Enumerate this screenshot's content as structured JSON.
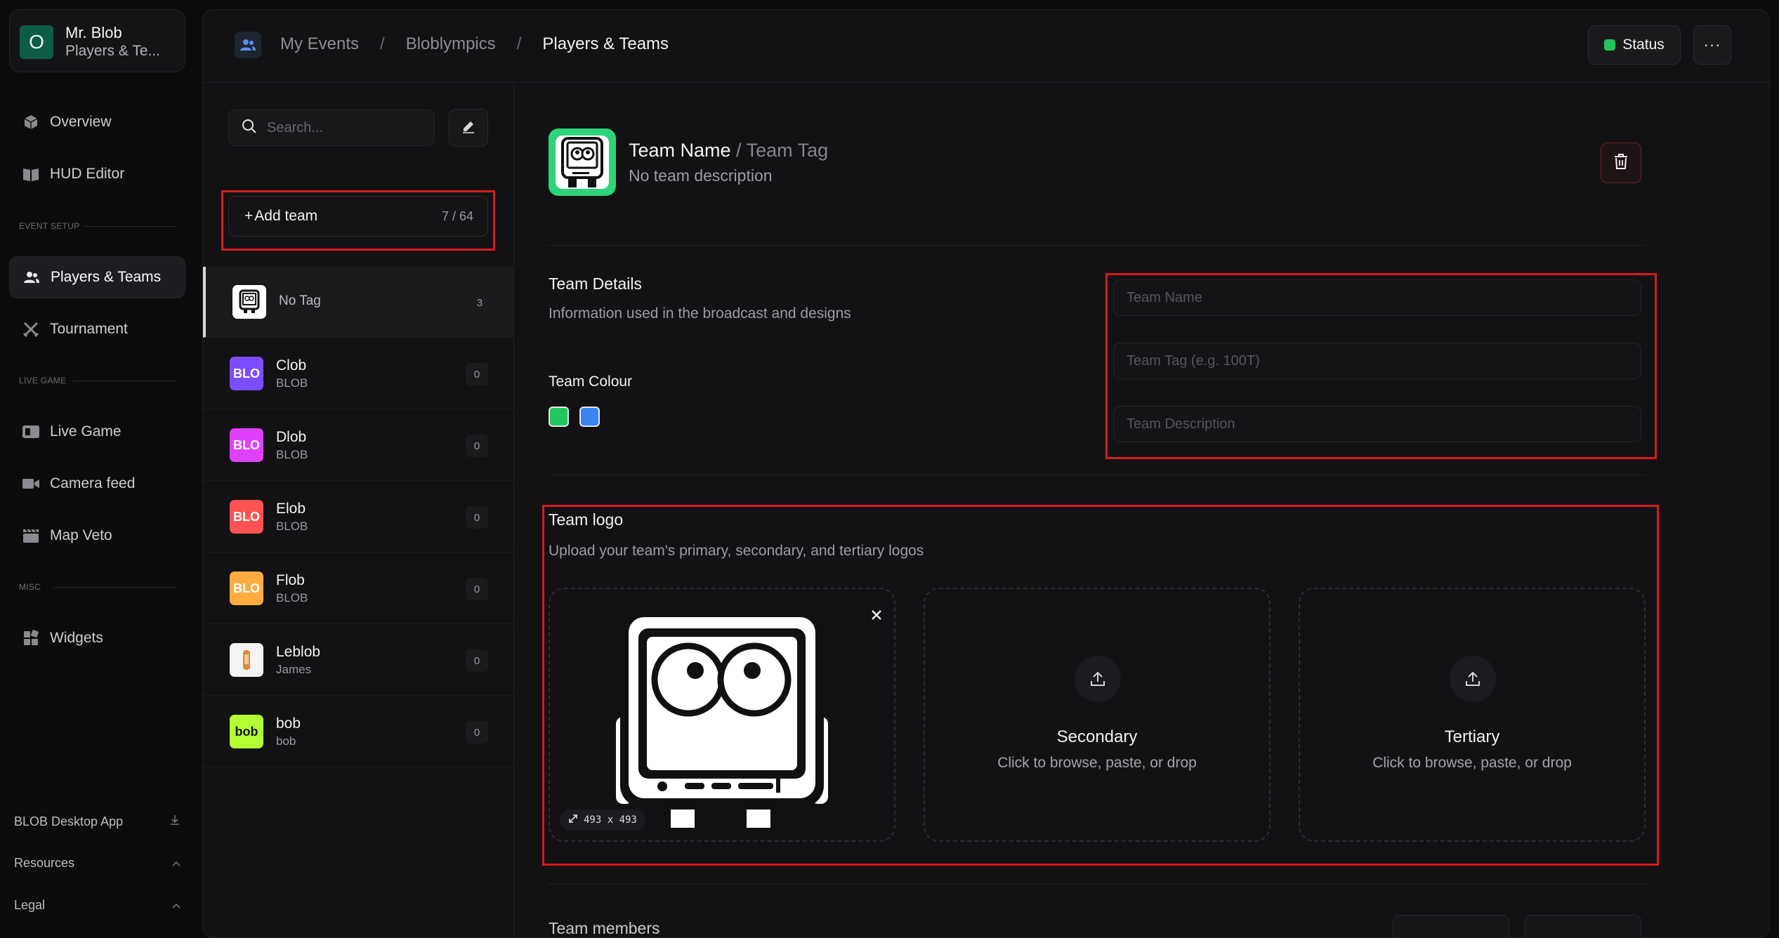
{
  "user": {
    "avatar_letter": "O",
    "name": "Mr. Blob",
    "subtitle": "Players & Te..."
  },
  "nav": {
    "overview": "Overview",
    "hud_editor": "HUD Editor",
    "event_setup_label": "EVENT SETUP",
    "players_teams": "Players & Teams",
    "tournament": "Tournament",
    "live_game_label": "LIVE GAME",
    "live_game": "Live Game",
    "camera_feed": "Camera feed",
    "map_veto": "Map Veto",
    "misc_label": "MISC",
    "widgets": "Widgets"
  },
  "footer": {
    "desktop_app": "BLOB Desktop App",
    "resources": "Resources",
    "legal": "Legal"
  },
  "breadcrumb": {
    "level1": "My Events",
    "level2": "Bloblympics",
    "level3": "Players & Teams",
    "separator": "/"
  },
  "header": {
    "status_label": "Status",
    "status_color": "#22c55e",
    "more_label": "···"
  },
  "team_list": {
    "search_placeholder": "Search...",
    "add_team_label": "Add team",
    "add_team_count": "7 / 64",
    "teams": [
      {
        "name": "No Tag",
        "tag": "",
        "count": "3",
        "logo_text": "",
        "logo_color": "#ffffff"
      },
      {
        "name": "Clob",
        "tag": "BLOB",
        "count": "0",
        "logo_text": "BLO",
        "logo_color": "#7c4dff"
      },
      {
        "name": "Dlob",
        "tag": "BLOB",
        "count": "0",
        "logo_text": "BLO",
        "logo_color": "#e040fb"
      },
      {
        "name": "Elob",
        "tag": "BLOB",
        "count": "0",
        "logo_text": "BLO",
        "logo_color": "#ff5252"
      },
      {
        "name": "Flob",
        "tag": "BLOB",
        "count": "0",
        "logo_text": "BLO",
        "logo_color": "#ffab40"
      },
      {
        "name": "Leblob",
        "tag": "James",
        "count": "0",
        "logo_text": "",
        "logo_color": "#ffffff"
      },
      {
        "name": "bob",
        "tag": "bob",
        "count": "0",
        "logo_text": "bob",
        "logo_color": "#b2ff33"
      }
    ]
  },
  "team_header": {
    "name": "Team Name",
    "tag_suffix": " / Team Tag",
    "description": "No team description"
  },
  "details": {
    "title": "Team Details",
    "subtitle": "Information used in the broadcast and designs",
    "colour_label": "Team Colour",
    "primary_color": "#22c55e",
    "secondary_color": "#3b82f6",
    "name_placeholder": "Team Name",
    "tag_placeholder": "Team Tag (e.g. 100T)",
    "description_placeholder": "Team Description"
  },
  "logo_section": {
    "title": "Team logo",
    "subtitle": "Upload your team's primary, secondary, and tertiary logos",
    "primary_dims": "493 x 493",
    "secondary_title": "Secondary",
    "tertiary_title": "Tertiary",
    "drop_hint": "Click to browse, paste, or drop"
  },
  "members": {
    "title": "Team members"
  }
}
